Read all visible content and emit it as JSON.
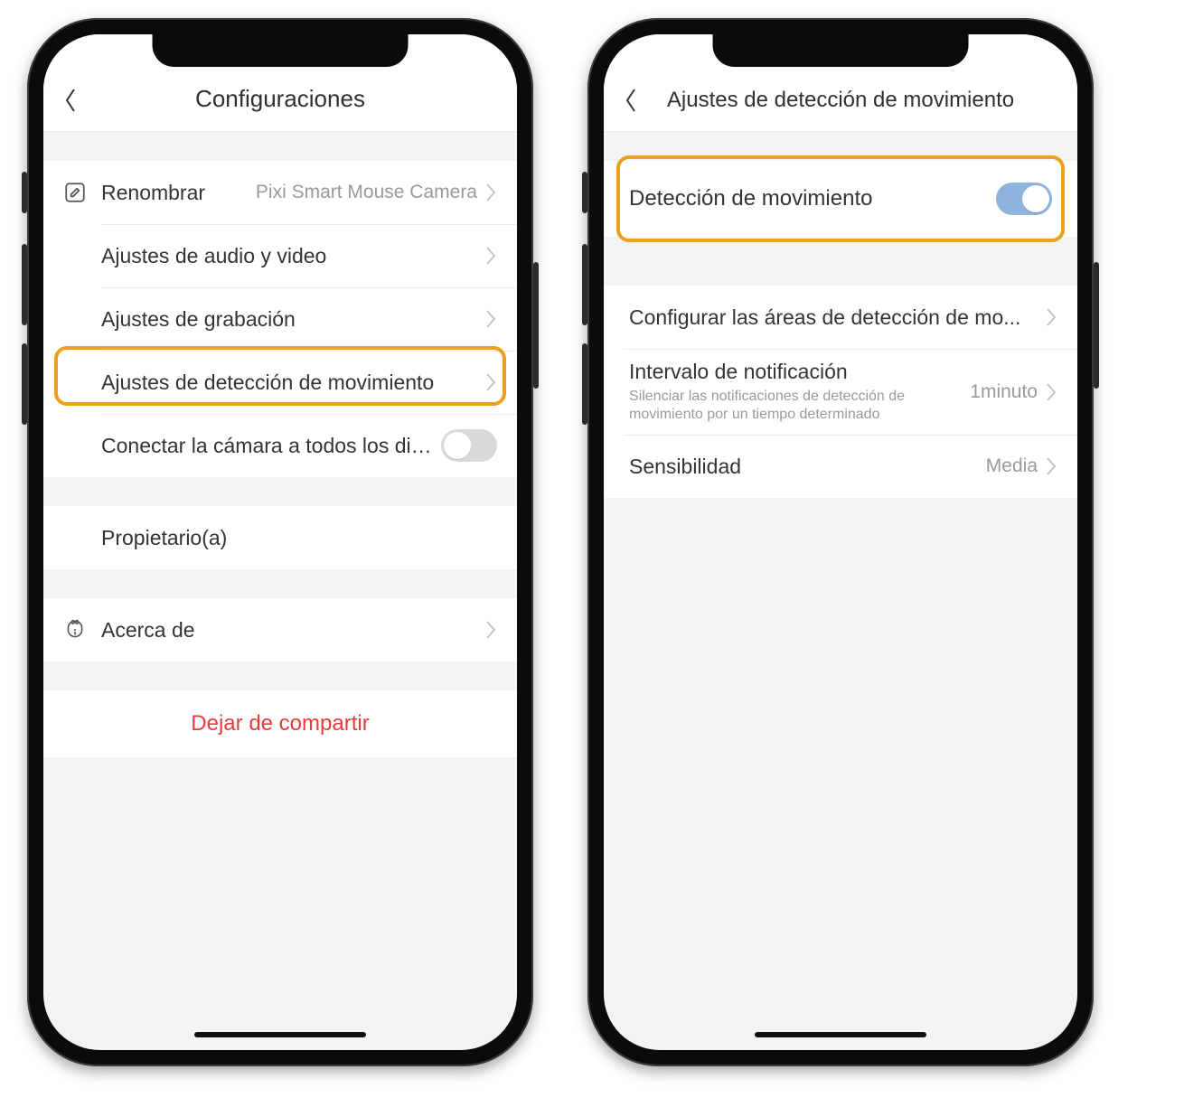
{
  "left": {
    "title": "Configuraciones",
    "rows": {
      "rename_label": "Renombrar",
      "rename_value": "Pixi Smart Mouse Camera",
      "av_label": "Ajustes de audio y video",
      "rec_label": "Ajustes de grabación",
      "motion_label": "Ajustes de detección de movimiento",
      "connect_label": "Conectar la cámara a todos los dispo...",
      "owner_label": "Propietario(a)",
      "about_label": "Acerca de"
    },
    "danger_label": "Dejar de compartir"
  },
  "right": {
    "title": "Ajustes de detección de movimiento",
    "rows": {
      "detect_label": "Detección de movimiento",
      "areas_label": "Configurar las áreas de detección de mo...",
      "interval_label": "Intervalo de notificación",
      "interval_sub": "Silenciar las notificaciones de detección de movimiento por un tiempo determinado",
      "interval_value": "1minuto",
      "sensitivity_label": "Sensibilidad",
      "sensitivity_value": "Media"
    }
  }
}
